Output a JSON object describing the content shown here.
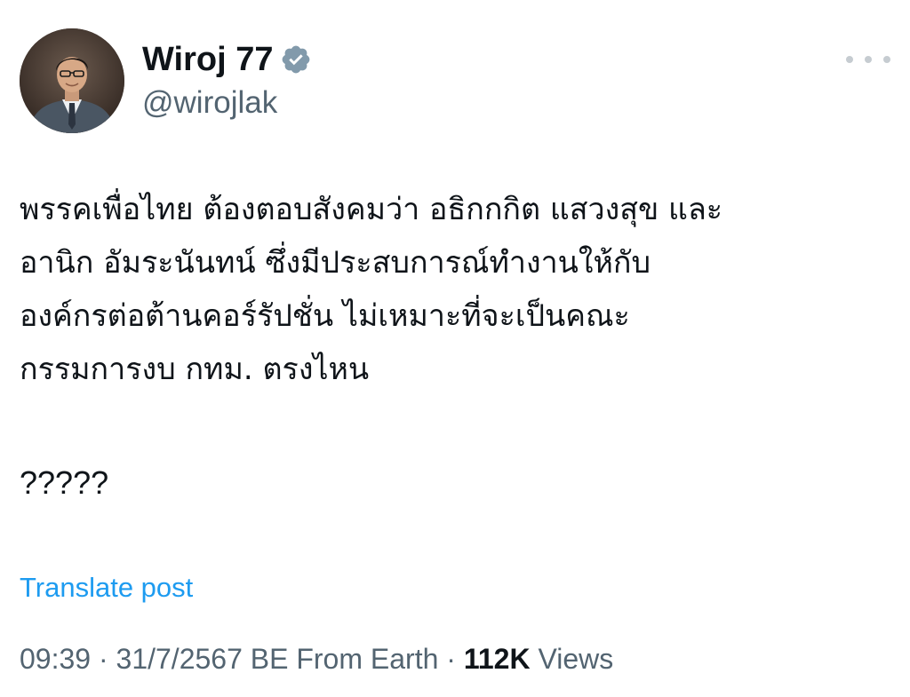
{
  "author": {
    "display_name": "Wiroj 77",
    "handle": "@wirojlak",
    "verified": true,
    "avatar_icon": "profile-photo"
  },
  "more_icon": "more-horizontal-icon",
  "post": {
    "lines": [
      "พรรคเพื่อไทย ต้องตอบสังคมว่า อธิกกกิต แสวงสุข และ",
      "อานิก อัมระนันทน์ ซึ่งมีประสบการณ์ทำงานให้กับ",
      "องค์กรต่อต้านคอร์รัปชั่น ไม่เหมาะที่จะเป็นคณะ",
      "กรรมการงบ กทม. ตรงไหน"
    ],
    "question_marks": "?????"
  },
  "translate_label": "Translate post",
  "meta": {
    "time": "09:39",
    "separator1": " · ",
    "date": "31/7/2567 BE",
    "source": " From Earth",
    "separator2": " · ",
    "views_count": "112K",
    "views_label": " Views"
  },
  "colors": {
    "text_primary": "#0f1419",
    "text_secondary": "#536471",
    "link": "#1d9bf0",
    "verified_badge": "#829aab"
  }
}
